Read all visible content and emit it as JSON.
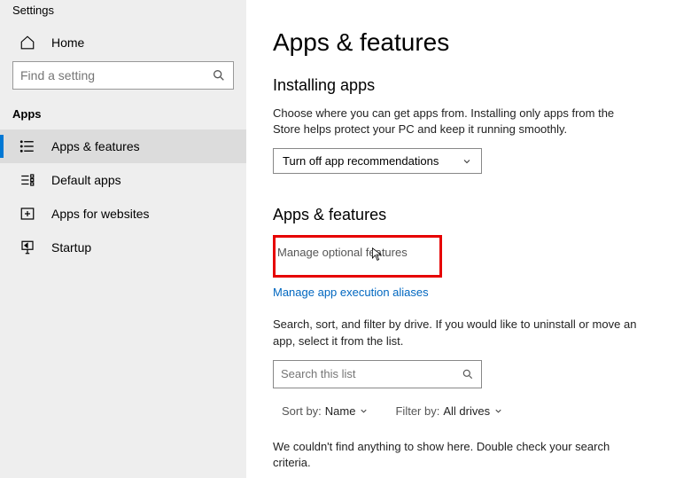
{
  "window_title": "Settings",
  "sidebar": {
    "home_label": "Home",
    "search_placeholder": "Find a setting",
    "section_label": "Apps",
    "items": [
      {
        "label": "Apps & features",
        "selected": true
      },
      {
        "label": "Default apps"
      },
      {
        "label": "Apps for websites"
      },
      {
        "label": "Startup"
      }
    ]
  },
  "main": {
    "title": "Apps & features",
    "installing": {
      "heading": "Installing apps",
      "description": "Choose where you can get apps from. Installing only apps from the Store helps protect your PC and keep it running smoothly.",
      "dropdown_value": "Turn off app recommendations"
    },
    "features": {
      "heading": "Apps & features",
      "link_optional": "Manage optional features",
      "link_aliases": "Manage app execution aliases",
      "description": "Search, sort, and filter by drive. If you would like to uninstall or move an app, select it from the list.",
      "search_placeholder": "Search this list",
      "sort_label": "Sort by:",
      "sort_value": "Name",
      "filter_label": "Filter by:",
      "filter_value": "All drives",
      "empty_message": "We couldn't find anything to show here. Double check your search criteria."
    }
  }
}
